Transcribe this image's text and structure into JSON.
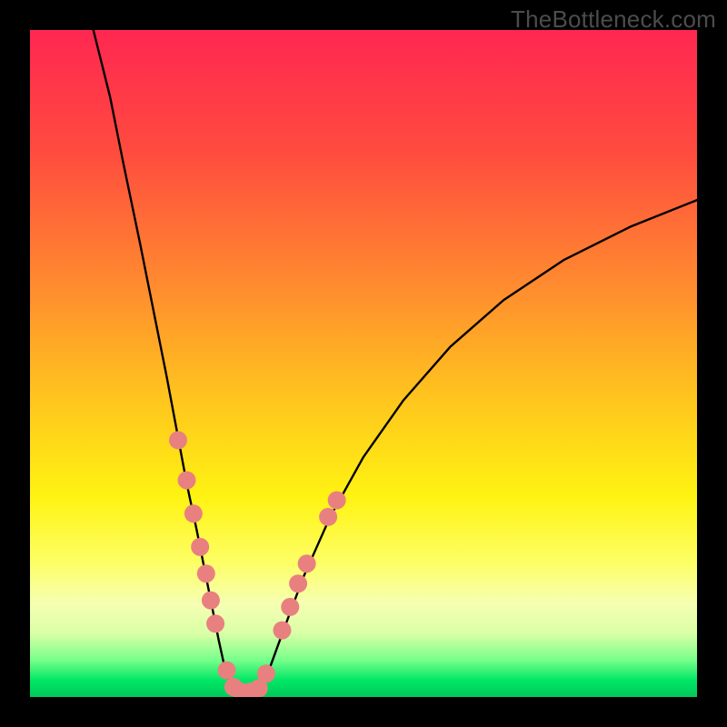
{
  "watermark": {
    "text": "TheBottleneck.com"
  },
  "frame": {
    "outer_size": 800,
    "border": 33,
    "border_color": "#000000"
  },
  "gradient": {
    "stops": [
      {
        "offset": 0.0,
        "color": "#ff2751"
      },
      {
        "offset": 0.18,
        "color": "#ff4b3f"
      },
      {
        "offset": 0.38,
        "color": "#ff8a2f"
      },
      {
        "offset": 0.55,
        "color": "#ffc41e"
      },
      {
        "offset": 0.7,
        "color": "#fff312"
      },
      {
        "offset": 0.8,
        "color": "#fdff67"
      },
      {
        "offset": 0.86,
        "color": "#f6ffb2"
      },
      {
        "offset": 0.905,
        "color": "#d9ffa6"
      },
      {
        "offset": 0.945,
        "color": "#76ff8a"
      },
      {
        "offset": 0.975,
        "color": "#00e765"
      },
      {
        "offset": 1.0,
        "color": "#00c95a"
      }
    ]
  },
  "chart_data": {
    "type": "line",
    "title": "",
    "xlabel": "",
    "ylabel": "",
    "xlim": [
      0,
      100
    ],
    "ylim": [
      0,
      100
    ],
    "series": [
      {
        "name": "left-branch",
        "x": [
          9.5,
          12,
          14,
          16.5,
          18.5,
          20.5,
          22,
          23.5,
          25,
          26.3,
          27.5,
          28.3,
          29.0,
          29.7,
          30.3,
          30.8
        ],
        "y": [
          100,
          90,
          80,
          68,
          58,
          48,
          40,
          32,
          25,
          18.5,
          12.5,
          8.5,
          5.3,
          3.0,
          1.5,
          0.8
        ]
      },
      {
        "name": "valley",
        "x": [
          30.8,
          31.5,
          32.5,
          33.5,
          34.5
        ],
        "y": [
          0.8,
          0.5,
          0.5,
          0.6,
          1.0
        ]
      },
      {
        "name": "right-branch",
        "x": [
          34.5,
          36,
          38,
          41,
          45,
          50,
          56,
          63,
          71,
          80,
          90,
          100
        ],
        "y": [
          1.0,
          4.5,
          10,
          18,
          27,
          36,
          44.5,
          52.5,
          59.5,
          65.5,
          70.5,
          74.5
        ]
      }
    ],
    "markers": {
      "name": "scatter-dots",
      "color": "#e98080",
      "radius_px": 10,
      "points": [
        {
          "x": 22.2,
          "y": 38.5
        },
        {
          "x": 23.5,
          "y": 32.5
        },
        {
          "x": 24.5,
          "y": 27.5
        },
        {
          "x": 25.5,
          "y": 22.5
        },
        {
          "x": 26.4,
          "y": 18.5
        },
        {
          "x": 27.1,
          "y": 14.5
        },
        {
          "x": 27.8,
          "y": 11.0
        },
        {
          "x": 29.5,
          "y": 4.0
        },
        {
          "x": 30.5,
          "y": 1.5
        },
        {
          "x": 31.6,
          "y": 0.8
        },
        {
          "x": 33.1,
          "y": 0.8
        },
        {
          "x": 34.3,
          "y": 1.3
        },
        {
          "x": 35.4,
          "y": 3.5
        },
        {
          "x": 37.8,
          "y": 10.0
        },
        {
          "x": 39.0,
          "y": 13.5
        },
        {
          "x": 40.2,
          "y": 17.0
        },
        {
          "x": 41.5,
          "y": 20.0
        },
        {
          "x": 44.7,
          "y": 27.0
        },
        {
          "x": 46.0,
          "y": 29.5
        }
      ]
    }
  }
}
